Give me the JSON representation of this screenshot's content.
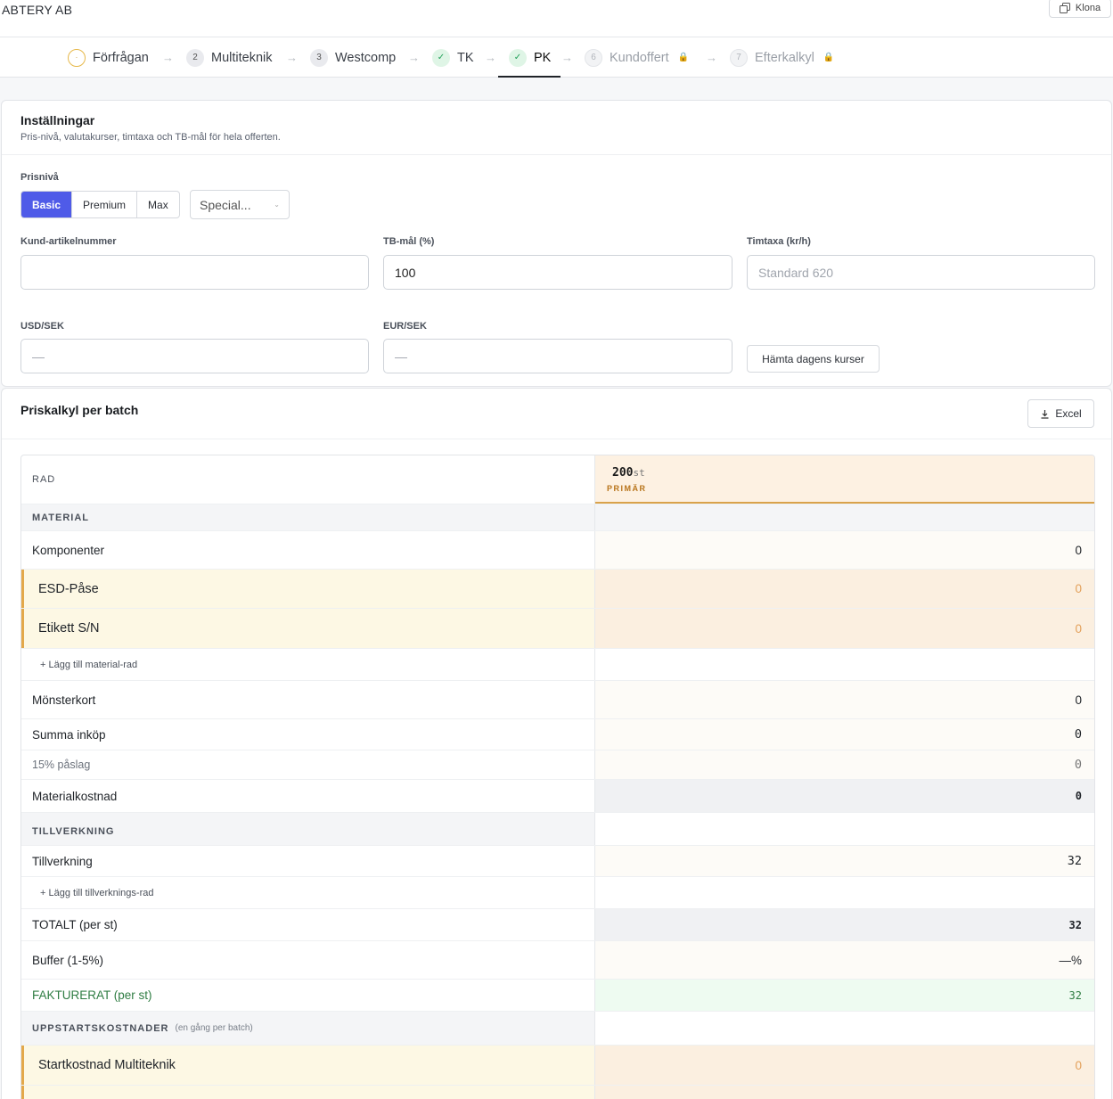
{
  "header": {
    "company": "ABTERY AB",
    "clone_label": "Klona"
  },
  "steps": [
    {
      "num": "·",
      "label": "Förfrågan",
      "state": "pending"
    },
    {
      "num": "2",
      "label": "Multiteknik",
      "state": "normal"
    },
    {
      "num": "3",
      "label": "Westcomp",
      "state": "normal"
    },
    {
      "num": "✓",
      "label": "TK",
      "state": "done"
    },
    {
      "num": "✓",
      "label": "PK",
      "state": "active"
    },
    {
      "num": "6",
      "label": "Kundoffert",
      "state": "locked"
    },
    {
      "num": "7",
      "label": "Efterkalkyl",
      "state": "locked"
    }
  ],
  "arrow": "→",
  "lock_icon": "🔒",
  "settings": {
    "title": "Inställningar",
    "subtitle": "Pris-nivå, valutakurser, timtaxa och TB-mål för hela offerten.",
    "price_level_label": "Prisnivå",
    "price_levels": [
      "Basic",
      "Premium",
      "Max"
    ],
    "selected_price_level": "Basic",
    "special_select": "Special...",
    "customer_article_label": "Kund-artikelnummer",
    "customer_article_value": "",
    "tb_label": "TB-mål (%)",
    "tb_value": "100",
    "rate_label": "Timtaxa (kr/h)",
    "rate_placeholder": "Standard 620",
    "usd_label": "USD/SEK",
    "usd_value": "—",
    "eur_label": "EUR/SEK",
    "eur_value": "—",
    "fetch_rates_label": "Hämta dagens kurser"
  },
  "pricing": {
    "title": "Priskalkyl per batch",
    "excel_label": "Excel",
    "col_row_header": "RAD",
    "batch_qty": "200",
    "batch_unit": "st",
    "batch_primary": "PRIMÄR",
    "rows": {
      "material_section": "MATERIAL",
      "komponenter": {
        "label": "Komponenter",
        "value": "0"
      },
      "esd": {
        "label": "ESD-Påse",
        "value": "0"
      },
      "etikett": {
        "label": "Etikett S/N",
        "value": "0"
      },
      "add_material": "+ Lägg till material-rad",
      "monsterkort": {
        "label": "Mönsterkort",
        "value": "0"
      },
      "summa_inkop": {
        "label": "Summa inköp",
        "value": "0"
      },
      "paslag": {
        "label": "15% påslag",
        "value": "0"
      },
      "materialkostnad": {
        "label": "Materialkostnad",
        "value": "0"
      },
      "tillverkning_section": "TILLVERKNING",
      "tillverkning": {
        "label": "Tillverkning",
        "value": "32"
      },
      "add_tillverkning": "+ Lägg till tillverknings-rad",
      "totalt": {
        "label": "TOTALT (per st)",
        "value": "32"
      },
      "buffer": {
        "label": "Buffer (1-5%)",
        "value": "—",
        "unit": "%"
      },
      "fakturerat": {
        "label": "FAKTURERAT (per st)",
        "value": "32"
      },
      "uppstart_section": "UPPSTARTSKOSTNADER",
      "uppstart_note": "(en gång per batch)",
      "startkostnad": {
        "label": "Startkostnad Multiteknik",
        "value": "0"
      }
    }
  }
}
